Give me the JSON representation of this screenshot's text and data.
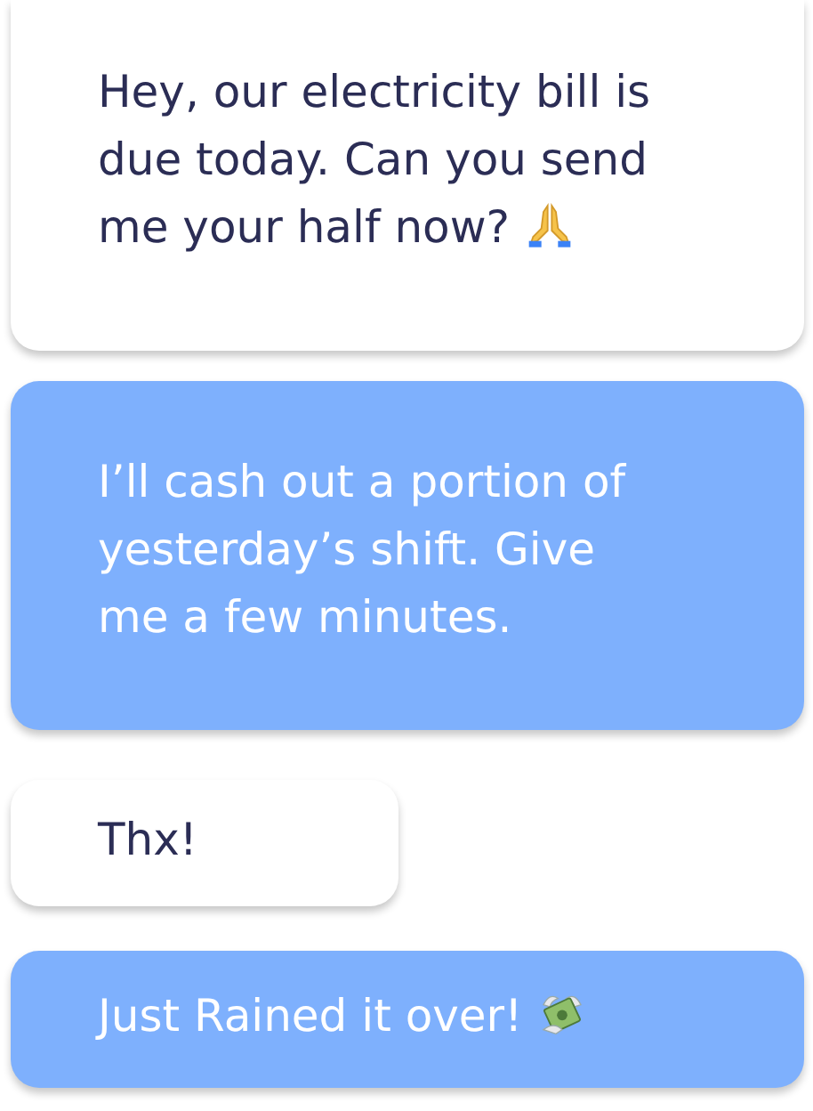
{
  "messages": [
    {
      "kind": "incoming",
      "text": "Hey, our electricity bill is due today. Can you send me your half now?",
      "emoji": true
    },
    {
      "kind": "outgoing",
      "text": "I’ll cash out a portion of yesterday’s shift. Give me a few minutes.",
      "emoji": false
    },
    {
      "kind": "incoming",
      "text": "Thx!",
      "emoji": false
    },
    {
      "kind": "outgoing",
      "text": "Just Rained it over!",
      "emoji": true
    }
  ]
}
